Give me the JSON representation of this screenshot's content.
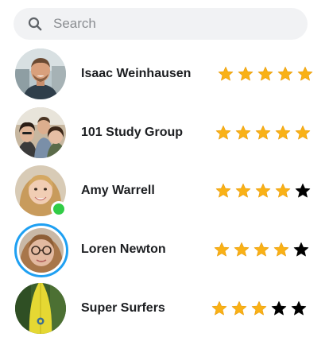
{
  "search": {
    "placeholder": "Search",
    "value": ""
  },
  "colors": {
    "star_filled": "#f9b116",
    "star_empty": "#000000",
    "presence": "#31cc46",
    "story_ring": "#1fa0f2",
    "search_bg": "#f1f2f4"
  },
  "contacts": [
    {
      "name": "Isaac Weinhausen",
      "rating": 5,
      "max_rating": 5,
      "online": false,
      "story_ring": false
    },
    {
      "name": "101 Study Group",
      "rating": 5,
      "max_rating": 5,
      "online": false,
      "story_ring": false
    },
    {
      "name": "Amy Warrell",
      "rating": 4,
      "max_rating": 5,
      "online": true,
      "story_ring": false
    },
    {
      "name": "Loren Newton",
      "rating": 4,
      "max_rating": 5,
      "online": false,
      "story_ring": true
    },
    {
      "name": "Super Surfers",
      "rating": 3,
      "max_rating": 5,
      "online": false,
      "story_ring": false
    }
  ]
}
